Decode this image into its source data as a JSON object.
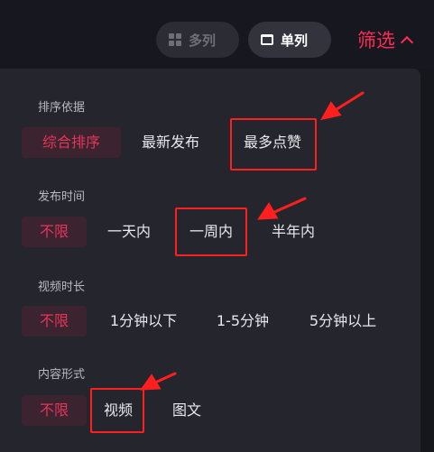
{
  "header": {
    "multi_column_label": "多列",
    "single_column_label": "单列",
    "filter_label": "筛选"
  },
  "filters": {
    "sort": {
      "title": "排序依据",
      "options": [
        "综合排序",
        "最新发布",
        "最多点赞"
      ],
      "selected": "综合排序"
    },
    "publish_time": {
      "title": "发布时间",
      "options": [
        "不限",
        "一天内",
        "一周内",
        "半年内"
      ],
      "selected": "不限"
    },
    "video_duration": {
      "title": "视频时长",
      "options": [
        "不限",
        "1分钟以下",
        "1-5分钟",
        "5分钟以上"
      ],
      "selected": "不限"
    },
    "content_type": {
      "title": "内容形式",
      "options": [
        "不限",
        "视频",
        "图文"
      ],
      "selected": "不限"
    }
  },
  "annotations": {
    "highlighted": [
      "最多点赞",
      "一周内",
      "视频"
    ],
    "color": "#ff1f1f"
  },
  "colors": {
    "accent": "#fe2c55",
    "selected_text": "#e5355a",
    "panel_bg": "#25252d",
    "page_bg": "#16161d"
  }
}
